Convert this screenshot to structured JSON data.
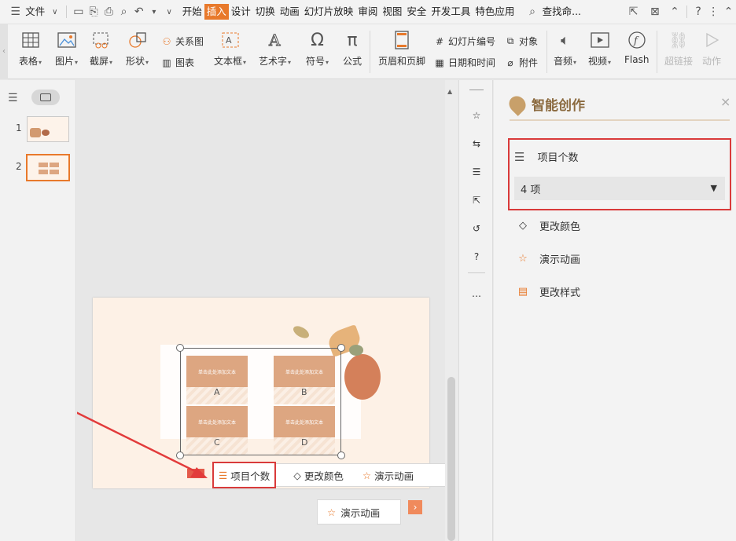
{
  "menubar": {
    "file": "文件",
    "tabs": [
      "开始",
      "插入",
      "设计",
      "切换",
      "动画",
      "幻灯片放映",
      "审阅",
      "视图",
      "安全",
      "开发工具",
      "特色应用"
    ],
    "active_tab": "插入",
    "search": "查找命..."
  },
  "ribbon": {
    "table": "表格",
    "picture": "图片",
    "screenshot": "截屏",
    "shape": "形状",
    "relation": "关系图",
    "chart": "图表",
    "textbox": "文本框",
    "wordart": "艺术字",
    "symbol": "符号",
    "formula": "公式",
    "header_footer": "页眉和页脚",
    "slide_number": "幻灯片编号",
    "datetime": "日期和时间",
    "object": "对象",
    "attachment": "附件",
    "audio": "音频",
    "video": "视频",
    "flash": "Flash",
    "hyperlink": "超链接",
    "action": "动作"
  },
  "thumbs": {
    "slides": [
      "1",
      "2"
    ]
  },
  "slide": {
    "card_text": "单击此处添加文本",
    "letters": [
      "A",
      "B",
      "C",
      "D"
    ]
  },
  "floatbar": {
    "item_count": "项目个数",
    "change_color": "更改颜色",
    "demo_animation": "演示动画",
    "demo_animation_btn": "演示动画"
  },
  "panel": {
    "title": "智能创作",
    "item_count_label": "项目个数",
    "item_count_value": "4 项",
    "change_color": "更改颜色",
    "demo_animation": "演示动画",
    "change_style": "更改样式"
  },
  "colors": {
    "accent": "#e8792b",
    "highlight": "#d93a3a",
    "card": "#dda681"
  }
}
